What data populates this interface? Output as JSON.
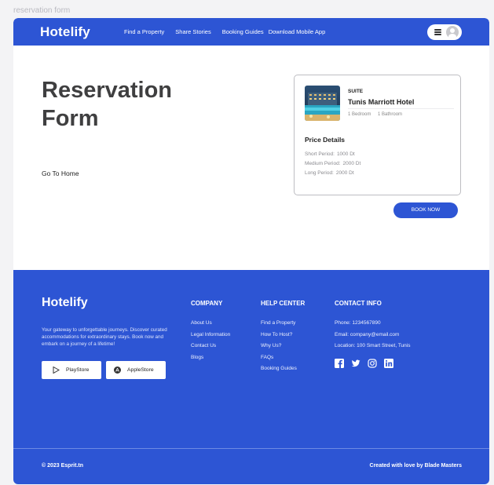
{
  "page_label": "reservation form",
  "navbar": {
    "brand": "Hotelify",
    "links": [
      "Find a Property",
      "Share Stories",
      "Booking Guides",
      "Download Mobile App"
    ]
  },
  "hero": {
    "title_line1": "Reservation",
    "title_line2": "Form",
    "home_link": "Go To Home"
  },
  "card": {
    "room_type": "SUITE",
    "hotel_name": "Tunis Marriott Hotel",
    "bedrooms": "1 Bedroom",
    "bathrooms": "1 Bathroom",
    "price_title": "Price Details",
    "prices": [
      {
        "label": "Short Period:",
        "value": "1000 Dt"
      },
      {
        "label": "Medium Period:",
        "value": "2000 Dt"
      },
      {
        "label": "Long Period:",
        "value": "2000 Dt"
      }
    ]
  },
  "book_button": "BOOK NOW",
  "footer": {
    "brand": "Hotelify",
    "description": "Your gateway to unforgettable journeys. Discover curated accommodations for extraordinary stays. Book now and embark on a journey of a lifetime!",
    "playstore": "PlayStore",
    "applestore": "AppleStore",
    "company": {
      "title": "COMPANY",
      "items": [
        "About Us",
        "Legal Information",
        "Contact Us",
        "Blogs"
      ]
    },
    "help": {
      "title": "HELP CENTER",
      "items": [
        "Find a Property",
        "How To Host?",
        "Why Us?",
        "FAQs",
        "Booking Guides"
      ]
    },
    "contact": {
      "title": "CONTACT INFO",
      "phone": "Phone: 1234567890",
      "email": "Email: company@email.com",
      "location": "Location: 100 Smart Street, Tunis"
    },
    "socials": [
      "facebook-icon",
      "twitter-icon",
      "instagram-icon",
      "linkedin-icon"
    ],
    "copyright": "© 2023 Esprit.tn",
    "credits": "Created with love by Blade Masters"
  },
  "colors": {
    "primary": "#2d55d4",
    "background": "#f3f3f5"
  }
}
